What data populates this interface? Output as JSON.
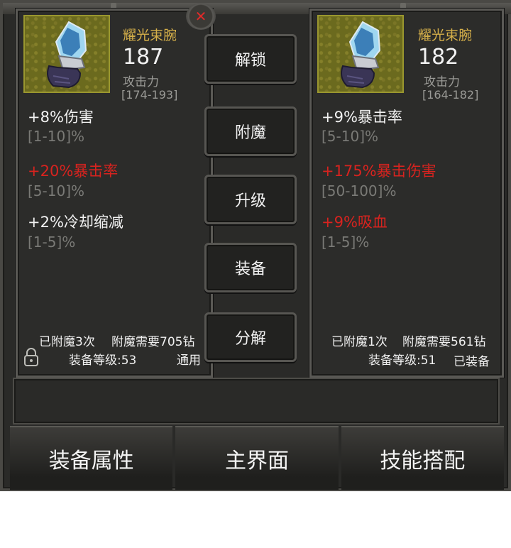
{
  "left_item": {
    "name": "耀光束腕",
    "attack": "187",
    "attack_label": "攻击力",
    "attack_range": "[174-193]",
    "stats": [
      {
        "text": "+8%伤害",
        "range": "[1-10]%",
        "color": "#f2f2f2"
      },
      {
        "text": "+20%暴击率",
        "range": "[5-10]%",
        "color": "#d8231f"
      },
      {
        "text": "+2%冷却缩减",
        "range": "[1-5]%",
        "color": "#f2f2f2"
      }
    ],
    "enchant_count": "已附魔3次",
    "enchant_cost": "附魔需要705钻",
    "equip_level": "装备等级:53",
    "tag": "通用"
  },
  "right_item": {
    "name": "耀光束腕",
    "attack": "182",
    "attack_label": "攻击力",
    "attack_range": "[164-182]",
    "stats": [
      {
        "text": "+9%暴击率",
        "range": "[5-10]%",
        "color": "#f2f2f2"
      },
      {
        "text": "+175%暴击伤害",
        "range": "[50-100]%",
        "color": "#d8231f"
      },
      {
        "text": "+9%吸血",
        "range": "[1-5]%",
        "color": "#d8231f"
      }
    ],
    "enchant_count": "已附魔1次",
    "enchant_cost": "附魔需要561钻",
    "equip_level": "装备等级:51",
    "tag": "已装备"
  },
  "actions": {
    "unlock": "解锁",
    "enchant": "附魔",
    "upgrade": "升级",
    "equip": "装备",
    "dismantle": "分解",
    "close": "✕"
  },
  "nav": {
    "equip_attributes": "装备属性",
    "main_screen": "主界面",
    "skill_config": "技能搭配"
  },
  "icons": {
    "item": "gauntlet-icon",
    "lock": "lock-icon",
    "close": "close-icon"
  },
  "colors": {
    "item_name": "#d6b04a",
    "red_stat": "#d8231f",
    "close_x": "#e02a2a"
  }
}
